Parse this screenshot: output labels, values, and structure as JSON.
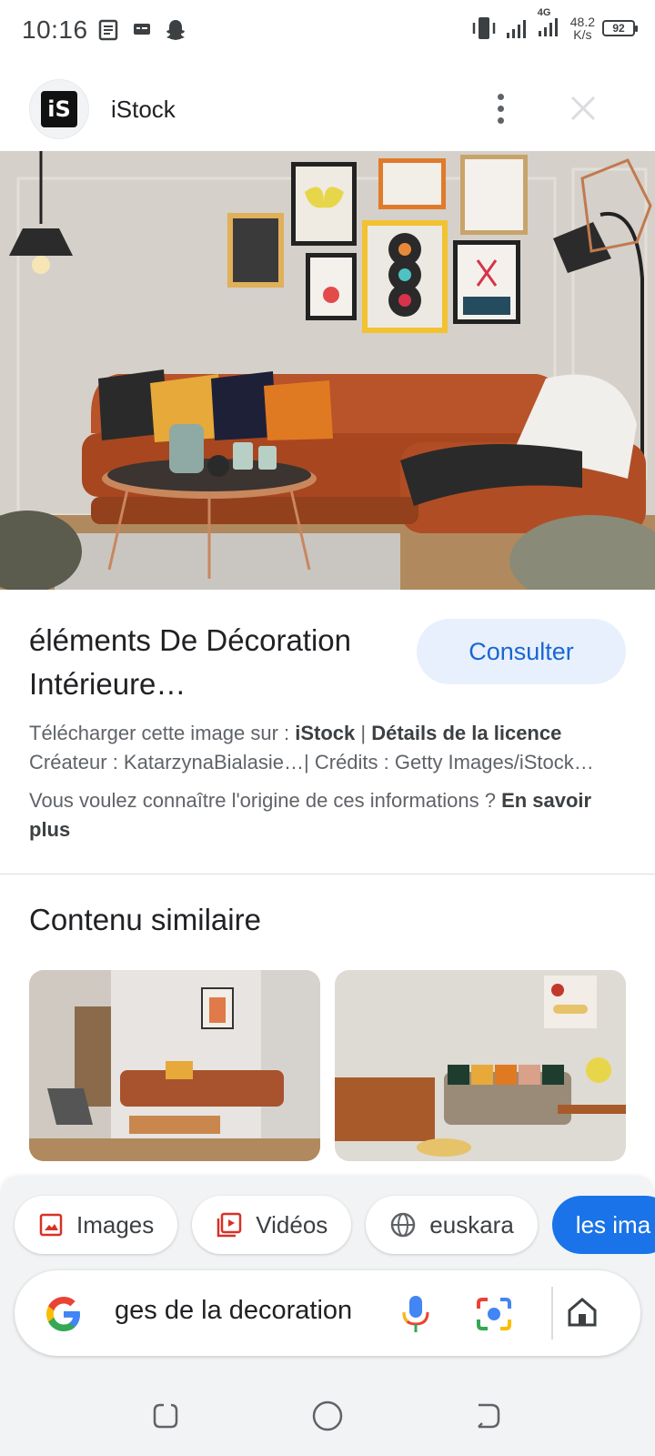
{
  "status_bar": {
    "time": "10:16",
    "net_speed_value": "48.2",
    "net_speed_unit": "K/s",
    "network_type": "4G",
    "battery": "92"
  },
  "source": {
    "logo_text": "iS",
    "name": "iStock"
  },
  "main_image": {
    "icon": "living-room-photo"
  },
  "result": {
    "title": "éléments De Décoration Intérieure…",
    "consult_label": "Consulter",
    "download_prefix": "Télécharger cette image sur : ",
    "download_site": "iStock",
    "separator": " | ",
    "license_details": "Détails de la licence",
    "creator_line": "Créateur : KatarzynaBialasie…| Crédits : Getty Images/iStock…",
    "origin_question": "Vous voulez connaître l'origine de ces informations ? ",
    "learn_more": "En savoir plus"
  },
  "similar": {
    "heading": "Contenu similaire"
  },
  "chips": [
    {
      "label": "Images",
      "icon": "image-icon"
    },
    {
      "label": "Vidéos",
      "icon": "video-icon"
    },
    {
      "label": "euskara",
      "icon": "globe-icon"
    },
    {
      "label": "les ima",
      "icon": ""
    }
  ],
  "search": {
    "query": "ges de la decoration"
  },
  "colors": {
    "accent": "#1a73e8",
    "consult_bg": "#e8f0fe",
    "consult_text": "#1967d2"
  }
}
